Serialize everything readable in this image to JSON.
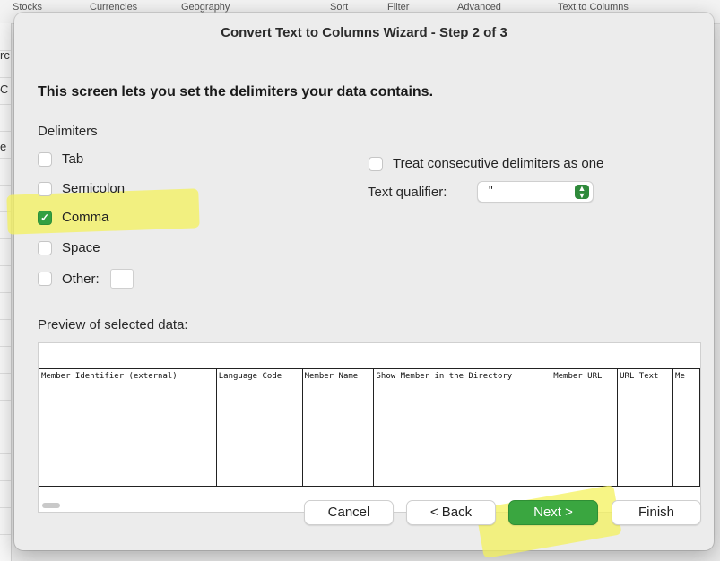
{
  "ribbon": {
    "items": [
      "Stocks",
      "Currencies",
      "Geography",
      "Sort",
      "Filter",
      "Advanced",
      "Text to Columns"
    ]
  },
  "sheet_edge_letters": [
    "rc",
    "C",
    "e"
  ],
  "dialog": {
    "title": "Convert Text to Columns Wizard - Step 2 of 3",
    "heading": "This screen lets you set the delimiters your data contains.",
    "delimiters_label": "Delimiters",
    "delimiters": [
      {
        "label": "Tab",
        "checked": false
      },
      {
        "label": "Semicolon",
        "checked": false
      },
      {
        "label": "Comma",
        "checked": true
      },
      {
        "label": "Space",
        "checked": false
      },
      {
        "label": "Other:",
        "checked": false
      }
    ],
    "consecutive": {
      "label": "Treat consecutive delimiters as one",
      "checked": false
    },
    "text_qualifier": {
      "label": "Text qualifier:",
      "value": "\""
    },
    "preview_label": "Preview of selected data:",
    "preview_columns": [
      "Member Identifier (external)",
      "Language Code",
      "Member Name",
      "Show Member in the Directory",
      "Member URL",
      "URL Text",
      "Me"
    ],
    "buttons": {
      "cancel": "Cancel",
      "back": "< Back",
      "next": "Next >",
      "finish": "Finish"
    },
    "colors": {
      "accent_green": "#3aa640",
      "highlighter": "#f4f25c"
    }
  }
}
